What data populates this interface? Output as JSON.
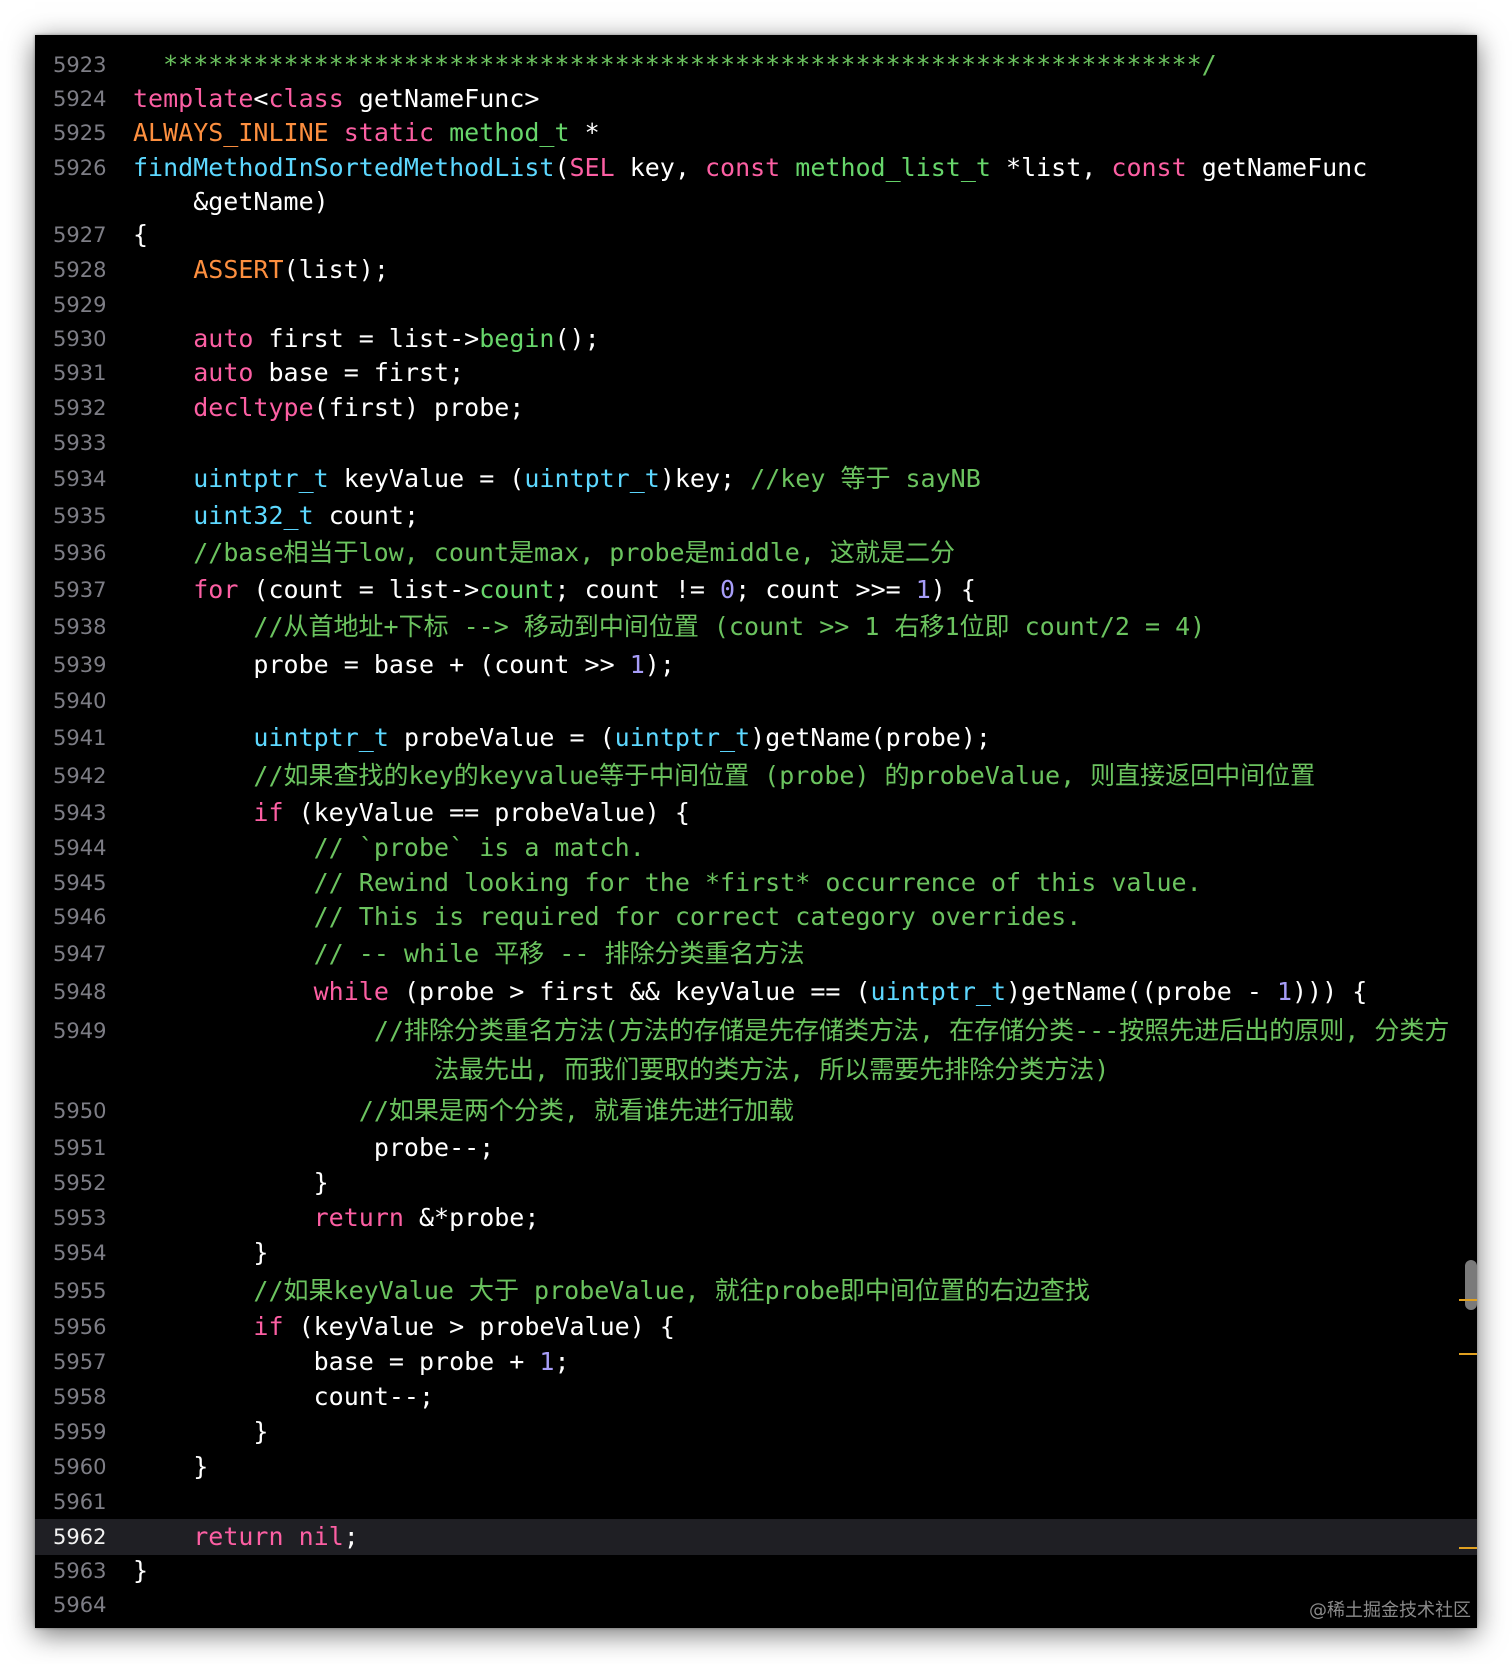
{
  "editor": {
    "current_line": "5962",
    "watermark": "@稀土掘金技术社区",
    "lines": [
      {
        "n": "5923",
        "segs": [
          [
            "cm",
            "  *********************************************************************/"
          ]
        ]
      },
      {
        "n": "5924",
        "segs": [
          [
            "kw",
            "template"
          ],
          [
            "pl",
            "<"
          ],
          [
            "kw",
            "class"
          ],
          [
            "pl",
            " getNameFunc>"
          ]
        ]
      },
      {
        "n": "5925",
        "segs": [
          [
            "or",
            "ALWAYS_INLINE"
          ],
          [
            "pl",
            " "
          ],
          [
            "kw",
            "static"
          ],
          [
            "pl",
            " "
          ],
          [
            "gr",
            "method_t"
          ],
          [
            "pl",
            " *"
          ]
        ]
      },
      {
        "n": "5926",
        "segs": [
          [
            "fn",
            "findMethodInSortedMethodList"
          ],
          [
            "pl",
            "("
          ],
          [
            "kw",
            "SEL"
          ],
          [
            "pl",
            " key, "
          ],
          [
            "kw",
            "const"
          ],
          [
            "pl",
            " "
          ],
          [
            "gr",
            "method_list_t"
          ],
          [
            "pl",
            " *list, "
          ],
          [
            "kw",
            "const"
          ],
          [
            "pl",
            " getNameFunc"
          ]
        ]
      },
      {
        "n": "",
        "segs": [
          [
            "pl",
            "    &getName)"
          ]
        ]
      },
      {
        "n": "5927",
        "segs": [
          [
            "pl",
            "{"
          ]
        ]
      },
      {
        "n": "5928",
        "segs": [
          [
            "pl",
            "    "
          ],
          [
            "or",
            "ASSERT"
          ],
          [
            "pl",
            "(list);"
          ]
        ]
      },
      {
        "n": "5929",
        "segs": []
      },
      {
        "n": "5930",
        "segs": [
          [
            "pl",
            "    "
          ],
          [
            "kw",
            "auto"
          ],
          [
            "pl",
            " first = list->"
          ],
          [
            "gr",
            "begin"
          ],
          [
            "pl",
            "();"
          ]
        ]
      },
      {
        "n": "5931",
        "segs": [
          [
            "pl",
            "    "
          ],
          [
            "kw",
            "auto"
          ],
          [
            "pl",
            " base = first;"
          ]
        ]
      },
      {
        "n": "5932",
        "segs": [
          [
            "pl",
            "    "
          ],
          [
            "kw",
            "decltype"
          ],
          [
            "pl",
            "(first) probe;"
          ]
        ]
      },
      {
        "n": "5933",
        "segs": []
      },
      {
        "n": "5934",
        "segs": [
          [
            "pl",
            "    "
          ],
          [
            "ty",
            "uintptr_t"
          ],
          [
            "pl",
            " keyValue = ("
          ],
          [
            "ty",
            "uintptr_t"
          ],
          [
            "pl",
            ")key; "
          ],
          [
            "cm",
            "//key 等于 sayNB"
          ]
        ]
      },
      {
        "n": "5935",
        "segs": [
          [
            "pl",
            "    "
          ],
          [
            "ty",
            "uint32_t"
          ],
          [
            "pl",
            " count;"
          ]
        ]
      },
      {
        "n": "5936",
        "segs": [
          [
            "pl",
            "    "
          ],
          [
            "cm",
            "//base相当于low, count是max, probe是middle, 这就是二分"
          ]
        ]
      },
      {
        "n": "5937",
        "segs": [
          [
            "pl",
            "    "
          ],
          [
            "kw",
            "for"
          ],
          [
            "pl",
            " (count = list->"
          ],
          [
            "gr",
            "count"
          ],
          [
            "pl",
            "; count != "
          ],
          [
            "nm",
            "0"
          ],
          [
            "pl",
            "; count >>= "
          ],
          [
            "nm",
            "1"
          ],
          [
            "pl",
            ") {"
          ]
        ]
      },
      {
        "n": "5938",
        "segs": [
          [
            "pl",
            "        "
          ],
          [
            "cm",
            "//从首地址+下标 --> 移动到中间位置 (count >> 1 右移1位即 count/2 = 4)"
          ]
        ]
      },
      {
        "n": "5939",
        "segs": [
          [
            "pl",
            "        probe = base + (count >> "
          ],
          [
            "nm",
            "1"
          ],
          [
            "pl",
            ");"
          ]
        ]
      },
      {
        "n": "5940",
        "segs": []
      },
      {
        "n": "5941",
        "segs": [
          [
            "pl",
            "        "
          ],
          [
            "ty",
            "uintptr_t"
          ],
          [
            "pl",
            " probeValue = ("
          ],
          [
            "ty",
            "uintptr_t"
          ],
          [
            "pl",
            ")getName(probe);"
          ]
        ]
      },
      {
        "n": "5942",
        "segs": [
          [
            "pl",
            "        "
          ],
          [
            "cm",
            "//如果查找的key的keyvalue等于中间位置 (probe) 的probeValue, 则直接返回中间位置"
          ]
        ]
      },
      {
        "n": "5943",
        "segs": [
          [
            "pl",
            "        "
          ],
          [
            "kw",
            "if"
          ],
          [
            "pl",
            " (keyValue == probeValue) {"
          ]
        ]
      },
      {
        "n": "5944",
        "segs": [
          [
            "pl",
            "            "
          ],
          [
            "cm",
            "// `probe` is a match."
          ]
        ]
      },
      {
        "n": "5945",
        "segs": [
          [
            "pl",
            "            "
          ],
          [
            "cm",
            "// Rewind looking for the *first* occurrence of this value."
          ]
        ]
      },
      {
        "n": "5946",
        "segs": [
          [
            "pl",
            "            "
          ],
          [
            "cm",
            "// This is required for correct category overrides."
          ]
        ]
      },
      {
        "n": "5947",
        "segs": [
          [
            "pl",
            "            "
          ],
          [
            "cm",
            "// -- while 平移 -- 排除分类重名方法"
          ]
        ]
      },
      {
        "n": "5948",
        "segs": [
          [
            "pl",
            "            "
          ],
          [
            "kw",
            "while"
          ],
          [
            "pl",
            " (probe > first && keyValue == ("
          ],
          [
            "ty",
            "uintptr_t"
          ],
          [
            "pl",
            ")getName((probe - "
          ],
          [
            "nm",
            "1"
          ],
          [
            "pl",
            "))) {"
          ]
        ]
      },
      {
        "n": "5949",
        "segs": [
          [
            "pl",
            "                "
          ],
          [
            "cm",
            "//排除分类重名方法(方法的存储是先存储类方法, 在存储分类---按照先进后出的原则, 分类方"
          ]
        ]
      },
      {
        "n": "",
        "segs": [
          [
            "pl",
            "                    "
          ],
          [
            "cm",
            "法最先出, 而我们要取的类方法, 所以需要先排除分类方法)"
          ]
        ]
      },
      {
        "n": "5950",
        "segs": [
          [
            "pl",
            "               "
          ],
          [
            "cm",
            "//如果是两个分类, 就看谁先进行加载"
          ]
        ]
      },
      {
        "n": "5951",
        "segs": [
          [
            "pl",
            "                probe--;"
          ]
        ]
      },
      {
        "n": "5952",
        "segs": [
          [
            "pl",
            "            }"
          ]
        ]
      },
      {
        "n": "5953",
        "segs": [
          [
            "pl",
            "            "
          ],
          [
            "kw",
            "return"
          ],
          [
            "pl",
            " &*probe;"
          ]
        ]
      },
      {
        "n": "5954",
        "segs": [
          [
            "pl",
            "        }"
          ]
        ]
      },
      {
        "n": "5955",
        "segs": [
          [
            "pl",
            "        "
          ],
          [
            "cm",
            "//如果keyValue 大于 probeValue, 就往probe即中间位置的右边查找"
          ]
        ]
      },
      {
        "n": "5956",
        "segs": [
          [
            "pl",
            "        "
          ],
          [
            "kw",
            "if"
          ],
          [
            "pl",
            " (keyValue > probeValue) {"
          ]
        ]
      },
      {
        "n": "5957",
        "segs": [
          [
            "pl",
            "            base = probe + "
          ],
          [
            "nm",
            "1"
          ],
          [
            "pl",
            ";"
          ]
        ]
      },
      {
        "n": "5958",
        "segs": [
          [
            "pl",
            "            count--;"
          ]
        ]
      },
      {
        "n": "5959",
        "segs": [
          [
            "pl",
            "        }"
          ]
        ]
      },
      {
        "n": "5960",
        "segs": [
          [
            "pl",
            "    }"
          ]
        ]
      },
      {
        "n": "5961",
        "segs": []
      },
      {
        "n": "5962",
        "segs": [
          [
            "pl",
            "    "
          ],
          [
            "kw",
            "return"
          ],
          [
            "pl",
            " "
          ],
          [
            "kw",
            "nil"
          ],
          [
            "pl",
            ";"
          ]
        ]
      },
      {
        "n": "5963",
        "segs": [
          [
            "pl",
            "}"
          ]
        ]
      },
      {
        "n": "5964",
        "segs": []
      }
    ]
  }
}
